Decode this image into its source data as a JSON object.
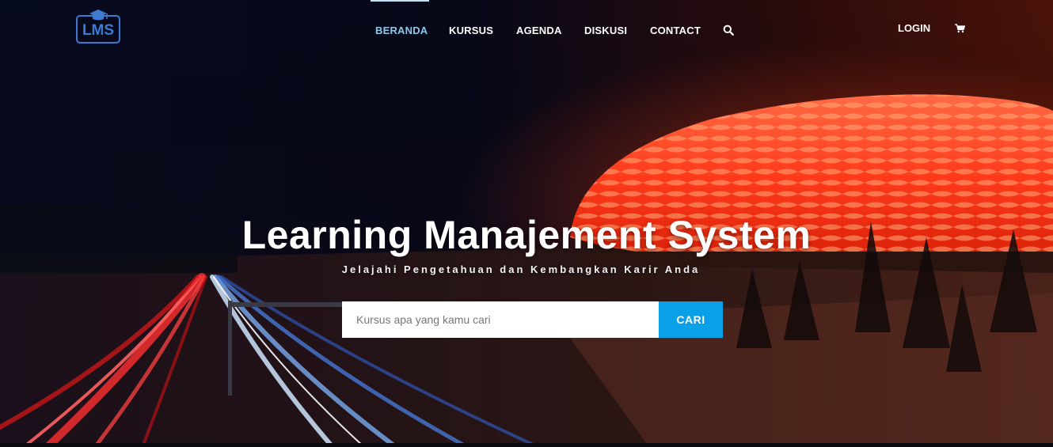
{
  "header": {
    "logo_text": "LMS",
    "nav": {
      "beranda": "BERANDA",
      "kursus": "KURSUS",
      "agenda": "AGENDA",
      "diskusi": "DISKUSI",
      "contact": "CONTACT"
    },
    "login_label": "LOGIN",
    "icons": {
      "search": "search-icon",
      "cart": "shopping-cart-icon",
      "logo": "graduation-cap-icon"
    }
  },
  "hero": {
    "title": "Learning Manajement System",
    "subtitle": "Jelajahi Pengetahuan dan Kembangkan Karir Anda",
    "search": {
      "placeholder": "Kursus apa yang kamu cari",
      "value": "",
      "button_label": "CARI"
    }
  },
  "colors": {
    "accent": "#0aa0e8",
    "active_nav": "#8ec9ea",
    "logo_blue": "#3d7bd1"
  }
}
